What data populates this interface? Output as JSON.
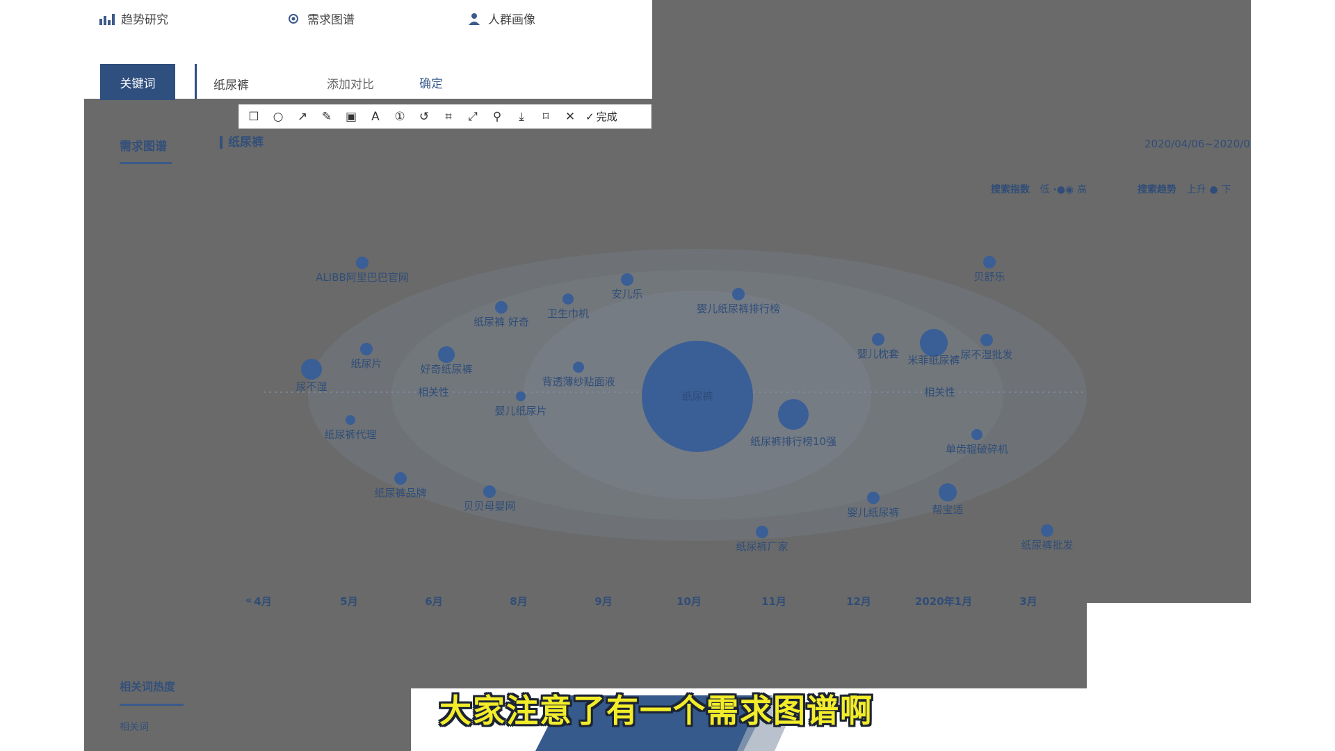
{
  "nav": {
    "items": [
      {
        "label": "趋势研究",
        "icon": "bar-chart-icon"
      },
      {
        "label": "需求图谱",
        "icon": "radar-icon"
      },
      {
        "label": "人群画像",
        "icon": "user-icon"
      }
    ]
  },
  "search": {
    "tab_label": "关键词",
    "keyword": "纸尿裤",
    "add_compare": "添加对比",
    "confirm": "确定"
  },
  "toolbar": {
    "tools": [
      {
        "name": "rectangle-tool",
        "glyph": "☐"
      },
      {
        "name": "ellipse-tool",
        "glyph": "○"
      },
      {
        "name": "arrow-tool",
        "glyph": "↗"
      },
      {
        "name": "pen-tool",
        "glyph": "✎"
      },
      {
        "name": "mosaic-tool",
        "glyph": "▣"
      },
      {
        "name": "text-tool",
        "glyph": "A"
      },
      {
        "name": "number-tool",
        "glyph": "①"
      },
      {
        "name": "undo-tool",
        "glyph": "↺"
      },
      {
        "name": "ocr-tool",
        "glyph": "⌗"
      },
      {
        "name": "fullscreen-tool",
        "glyph": "⤢"
      },
      {
        "name": "pin-tool",
        "glyph": "⚲"
      },
      {
        "name": "download-tool",
        "glyph": "⤓"
      },
      {
        "name": "bookmark-tool",
        "glyph": "⌑"
      },
      {
        "name": "close-tool",
        "glyph": "✕"
      }
    ],
    "done_label": "完成",
    "done_glyph": "✓"
  },
  "section": {
    "title": "需求图谱",
    "keyword_tag": "纸尿裤",
    "date_range": "2020/04/06~2020/0",
    "legend_search_index": "搜索指数",
    "legend_low": "低",
    "legend_high": "高",
    "legend_search_trend": "搜索趋势",
    "legend_up": "上升",
    "legend_down": "下"
  },
  "bubble_map": {
    "center": "纸尿裤",
    "axis_left_label": "相关性",
    "axis_right_label": "相关性",
    "bubbles": [
      {
        "label": "ALIBB阿里巴巴官网"
      },
      {
        "label": "安儿乐"
      },
      {
        "label": "卫生巾机"
      },
      {
        "label": "纸尿裤 好奇"
      },
      {
        "label": "婴儿纸尿裤排行榜"
      },
      {
        "label": "贝舒乐"
      },
      {
        "label": "纸尿片"
      },
      {
        "label": "好奇纸尿裤"
      },
      {
        "label": "尿不湿"
      },
      {
        "label": "背透薄纱贴面液"
      },
      {
        "label": "婴儿纸尿片"
      },
      {
        "label": "纸尿裤代理"
      },
      {
        "label": "婴儿枕套"
      },
      {
        "label": "米菲纸尿裤"
      },
      {
        "label": "尿不湿批发"
      },
      {
        "label": "纸尿裤排行榜10强"
      },
      {
        "label": "单齿辊破碎机"
      },
      {
        "label": "纸尿裤品牌"
      },
      {
        "label": "贝贝母婴网"
      },
      {
        "label": "婴儿纸尿裤"
      },
      {
        "label": "帮宝适"
      },
      {
        "label": "纸尿裤厂家"
      },
      {
        "label": "纸尿裤批发"
      }
    ],
    "months": [
      "4月",
      "5月",
      "6月",
      "8月",
      "9月",
      "10月",
      "11月",
      "12月",
      "2020年1月",
      "3月"
    ]
  },
  "related_heat": {
    "title": "相关词热度",
    "column": "相关词"
  },
  "subtitle": "大家注意了有一个需求图谱啊",
  "colors": {
    "accent": "#2f4f7f",
    "overlay": "#6a6a6a",
    "bubble": "#3a5e96",
    "subtitle": "#f2ec2a"
  }
}
